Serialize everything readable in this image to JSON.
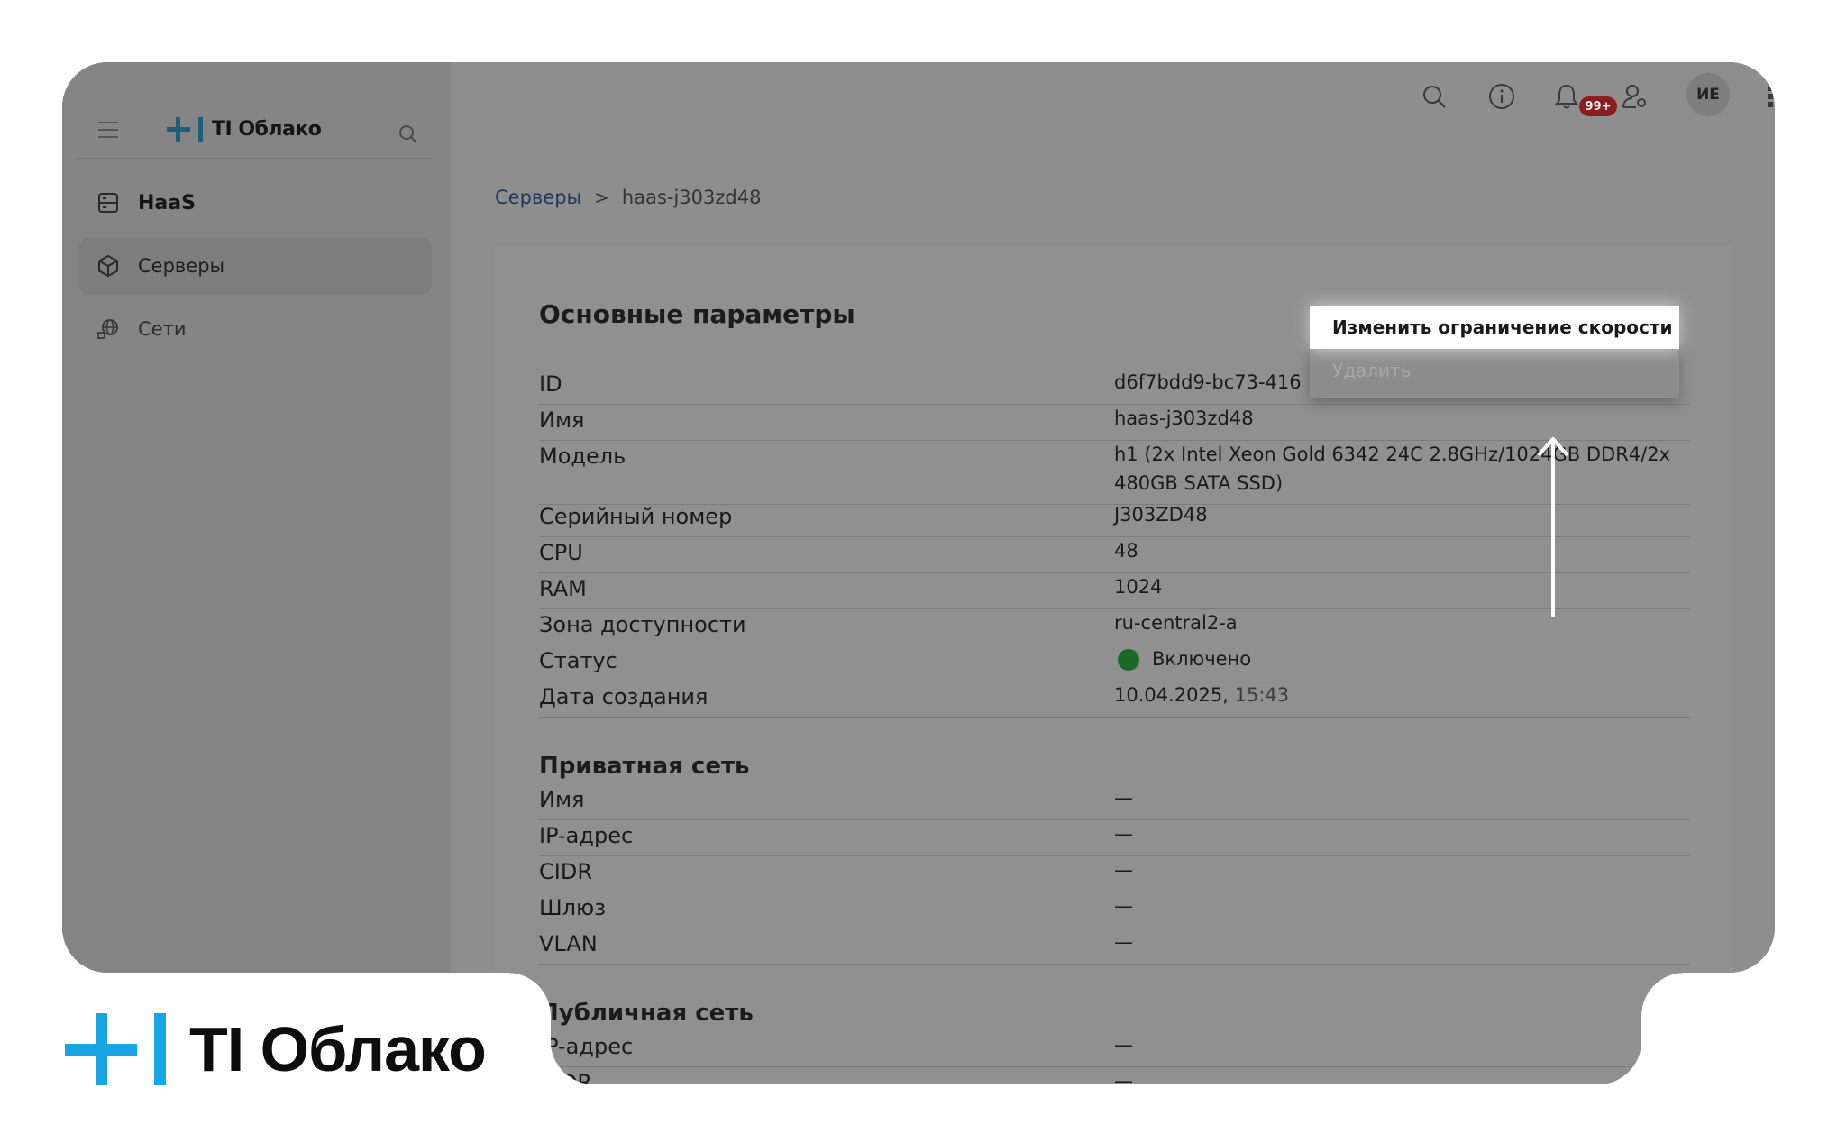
{
  "brand": {
    "name": "TI Облако",
    "accent_color": "#17a6e3"
  },
  "sidebar": {
    "items": [
      {
        "label": "HaaS",
        "icon": "server-icon"
      },
      {
        "label": "Серверы",
        "icon": "cube-icon",
        "active": true
      },
      {
        "label": "Сети",
        "icon": "network-globe-icon"
      }
    ]
  },
  "header": {
    "icons": [
      "search-icon",
      "info-icon",
      "bell-icon",
      "user-settings-icon",
      "apps-grid-icon"
    ],
    "notification_badge": "99+",
    "avatar_initials": "ИЕ"
  },
  "breadcrumb": {
    "parent": "Серверы",
    "current": "haas-j303zd48"
  },
  "main": {
    "title": "Основные параметры",
    "params": [
      {
        "label": "ID",
        "value": "d6f7bdd9-bc73-416"
      },
      {
        "label": "Имя",
        "value": "haas-j303zd48"
      },
      {
        "label": "Модель",
        "value": "h1 (2x Intel Xeon Gold 6342 24C 2.8GHz/1024GB DDR4/2x 480GB SATA SSD)"
      },
      {
        "label": "Серийный номер",
        "value": "J303ZD48"
      },
      {
        "label": "CPU",
        "value": "48"
      },
      {
        "label": "RAM",
        "value": "1024"
      },
      {
        "label": "Зона доступности",
        "value": "ru-central2-a"
      },
      {
        "label": "Статус",
        "value": "Включено"
      },
      {
        "label": "Дата создания",
        "value": "10.04.2025,",
        "time": "15:43"
      }
    ],
    "private_network": {
      "title": "Приватная сеть",
      "rows": [
        {
          "label": "Имя",
          "value": "—"
        },
        {
          "label": "IP-адрес",
          "value": "—"
        },
        {
          "label": "CIDR",
          "value": "—"
        },
        {
          "label": "Шлюз",
          "value": "—"
        },
        {
          "label": "VLAN",
          "value": "—"
        }
      ]
    },
    "public_network": {
      "title": "Публичная сеть",
      "rows": [
        {
          "label": "IP-адрес",
          "value": "—"
        },
        {
          "label": "CIDR",
          "value": "—"
        }
      ]
    }
  },
  "context_menu": {
    "items": [
      {
        "label": "Изменить ограничение скорости",
        "highlighted": true
      },
      {
        "label": "Удалить",
        "disabled": true
      }
    ]
  },
  "colors": {
    "status_on": "#1b6b27",
    "badge": "#8a1e1e"
  }
}
